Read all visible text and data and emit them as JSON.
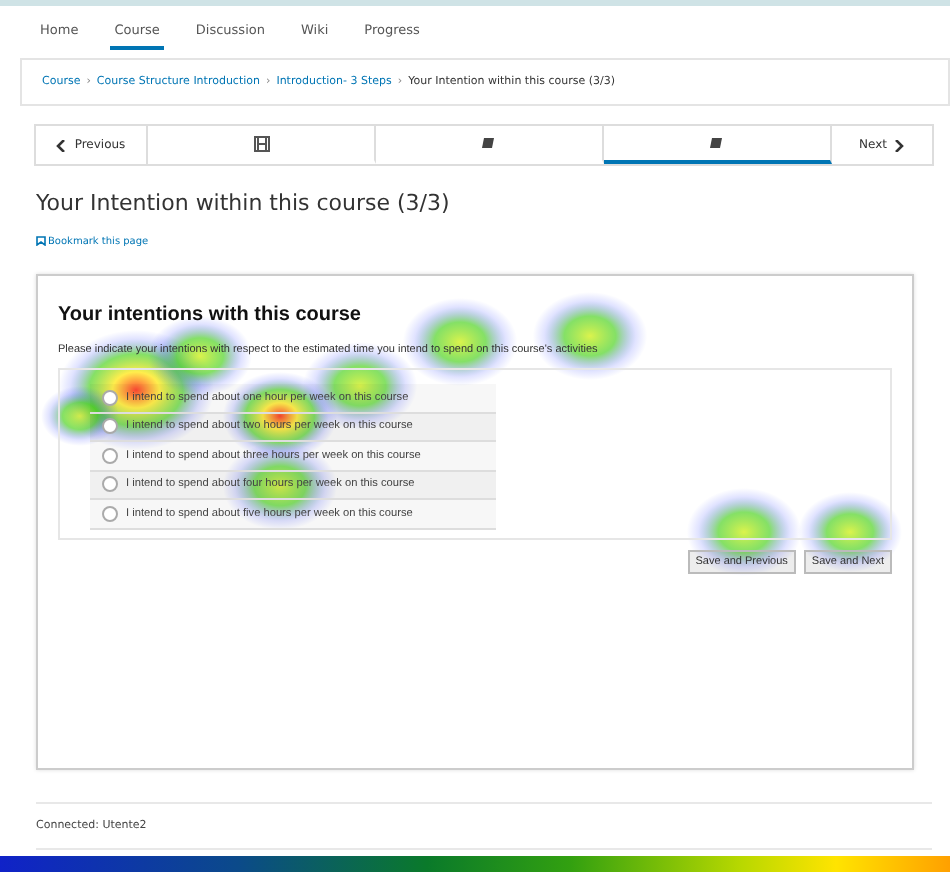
{
  "tabs": [
    {
      "label": "Home",
      "selected": false
    },
    {
      "label": "Course",
      "selected": true
    },
    {
      "label": "Discussion",
      "selected": false
    },
    {
      "label": "Wiki",
      "selected": false
    },
    {
      "label": "Progress",
      "selected": false
    }
  ],
  "breadcrumb": [
    {
      "kind": "link",
      "text": "Course"
    },
    {
      "kind": "separator",
      "text": "›"
    },
    {
      "kind": "link",
      "text": "Course Structure Introduction"
    },
    {
      "kind": "separator",
      "text": "›"
    },
    {
      "kind": "link",
      "text": "Introduction- 3 Steps"
    },
    {
      "kind": "separator",
      "text": "›"
    },
    {
      "kind": "current",
      "text": "Your Intention within this course (3/3)"
    }
  ],
  "unit_nav": {
    "previous": "Previous",
    "next": "Next",
    "units": [
      {
        "kind": "video",
        "selected": false
      },
      {
        "kind": "text",
        "selected": false
      },
      {
        "kind": "text",
        "selected": true
      }
    ]
  },
  "page_title": "Your Intention within this course (3/3)",
  "bookmark": "Bookmark this page",
  "survey": {
    "title": "Your intentions with this course",
    "instruction": "Please indicate your intentions with respect to the estimated time you intend to spend on this course's activities",
    "options": [
      {
        "label": "I intend to spend about one hour per week on this course",
        "selected": false
      },
      {
        "label": "I intend to spend about two hours per week on this course",
        "selected": false
      },
      {
        "label": "I intend to spend about three hours per week on this course",
        "selected": false
      },
      {
        "label": "I intend to spend about four hours per week on this course",
        "selected": false
      },
      {
        "label": "I intend to spend about five hours per week on this course",
        "selected": false
      }
    ],
    "buttons": [
      "Save and Previous",
      "Save and Next"
    ]
  },
  "status": "Connected: Utente2"
}
